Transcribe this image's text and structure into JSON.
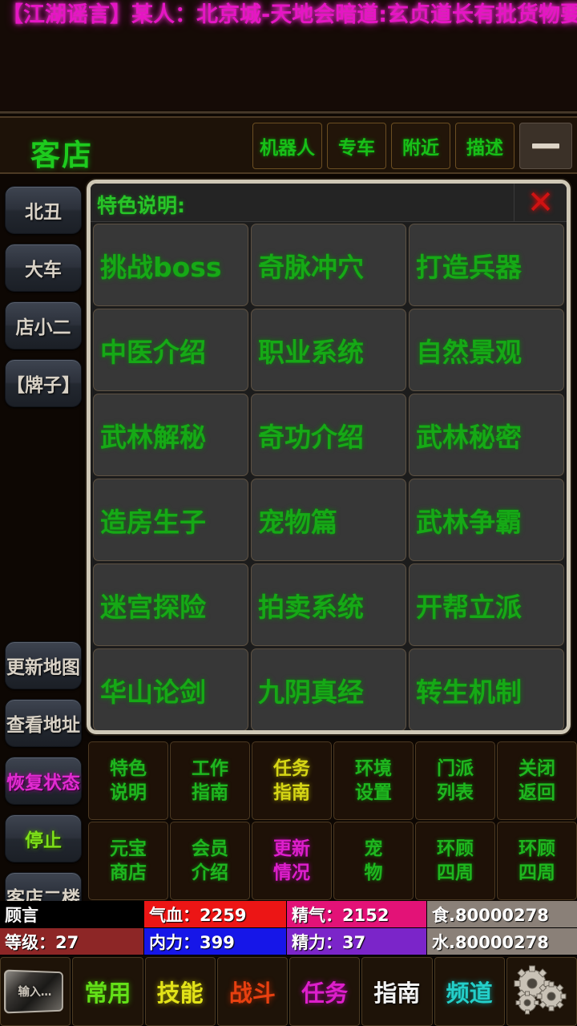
{
  "marquee": {
    "text": "【江湖谣言】某人：北京城-天地会暗道:玄贞道长有批货物要送到",
    "color": "#e516c4"
  },
  "titlebar": {
    "room_title": "客店",
    "buttons": [
      {
        "label": "机器人",
        "name": "robot-button"
      },
      {
        "label": "专车",
        "name": "transport-button"
      },
      {
        "label": "附近",
        "name": "nearby-button"
      },
      {
        "label": "描述",
        "name": "describe-button"
      }
    ],
    "minimize": {
      "icon": "minimize-icon",
      "label": ""
    }
  },
  "sidebar": {
    "top_items": [
      {
        "label": "北丑",
        "color": "default"
      },
      {
        "label": "大车",
        "color": "default"
      },
      {
        "label": "店小二",
        "color": "default"
      },
      {
        "label": "【牌子】",
        "color": "default"
      }
    ],
    "bottom_items": [
      {
        "label": "更新地图",
        "color": "default"
      },
      {
        "label": "查看地址",
        "color": "default"
      },
      {
        "label": "恢复状态",
        "color": "magenta"
      },
      {
        "label": "停止",
        "color": "green"
      },
      {
        "label": "客店二楼",
        "color": "default"
      }
    ]
  },
  "panel": {
    "title": "特色说明:",
    "close_icon": "close-icon",
    "close_glyph": "✕",
    "options": [
      "挑战boss",
      "奇脉冲穴",
      "打造兵器",
      "中医介绍",
      "职业系统",
      "自然景观",
      "武林解秘",
      "奇功介绍",
      "武林秘密",
      "造房生子",
      "宠物篇",
      "武林争霸",
      "迷宫探险",
      "拍卖系统",
      "开帮立派",
      "华山论剑",
      "九阴真经",
      "转生机制"
    ]
  },
  "commands": [
    {
      "line1": "特色",
      "line2": "说明",
      "color": "green"
    },
    {
      "line1": "工作",
      "line2": "指南",
      "color": "green"
    },
    {
      "line1": "任务",
      "line2": "指南",
      "color": "yellow"
    },
    {
      "line1": "环境",
      "line2": "设置",
      "color": "green"
    },
    {
      "line1": "门派",
      "line2": "列表",
      "color": "green"
    },
    {
      "line1": "关闭",
      "line2": "返回",
      "color": "green"
    },
    {
      "line1": "元宝",
      "line2": "商店",
      "color": "green"
    },
    {
      "line1": "会员",
      "line2": "介绍",
      "color": "green"
    },
    {
      "line1": "更新",
      "line2": "情况",
      "color": "magenta"
    },
    {
      "line1": "宠",
      "line2": "物",
      "color": "green"
    },
    {
      "line1": "环顾",
      "line2": "四周",
      "color": "green"
    },
    {
      "line1": "环顾",
      "line2": "四周",
      "color": "green"
    }
  ],
  "status": {
    "name": "顾言",
    "level": "等级：27",
    "hp": "气血：2259",
    "mp": "内力：399",
    "sp": "精气：2152",
    "force": "精力：37",
    "food": "食.80000278",
    "water": "水.80000278"
  },
  "bottomnav": {
    "input": {
      "label": "输入…",
      "name": "input-chip"
    },
    "items": [
      {
        "label": "常用",
        "color": "green"
      },
      {
        "label": "技能",
        "color": "yellow"
      },
      {
        "label": "战斗",
        "color": "red"
      },
      {
        "label": "任务",
        "color": "magenta"
      },
      {
        "label": "指南",
        "color": "white"
      },
      {
        "label": "频道",
        "color": "cyan"
      }
    ],
    "settings": {
      "icon": "gears-icon"
    }
  }
}
